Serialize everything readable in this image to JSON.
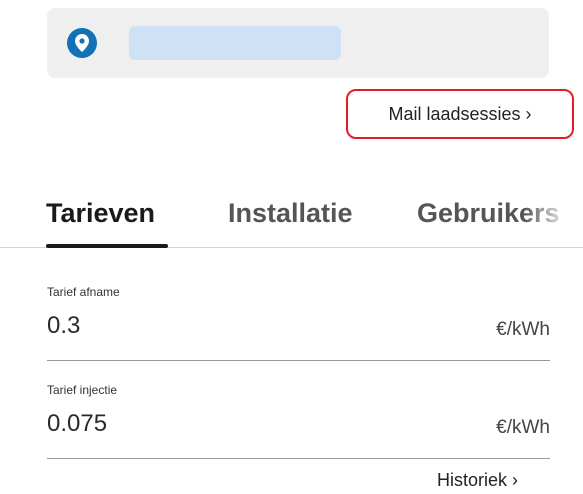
{
  "actions": {
    "mail_sessions_label": "Mail laadsessies ›",
    "history_label": "Historiek ›"
  },
  "tabs": [
    {
      "label": "Tarieven",
      "active": true
    },
    {
      "label": "Installatie",
      "active": false
    },
    {
      "label": "Gebruikers",
      "active": false
    }
  ],
  "fields": [
    {
      "label": "Tarief afname",
      "value": "0.3",
      "unit": "€/kWh"
    },
    {
      "label": "Tarief injectie",
      "value": "0.075",
      "unit": "€/kWh"
    }
  ],
  "colors": {
    "accent": "#1172b8",
    "highlight_border": "#e51c23",
    "placeholder": "#cfe2f5"
  },
  "icons": {
    "location": "location-pin-icon"
  }
}
